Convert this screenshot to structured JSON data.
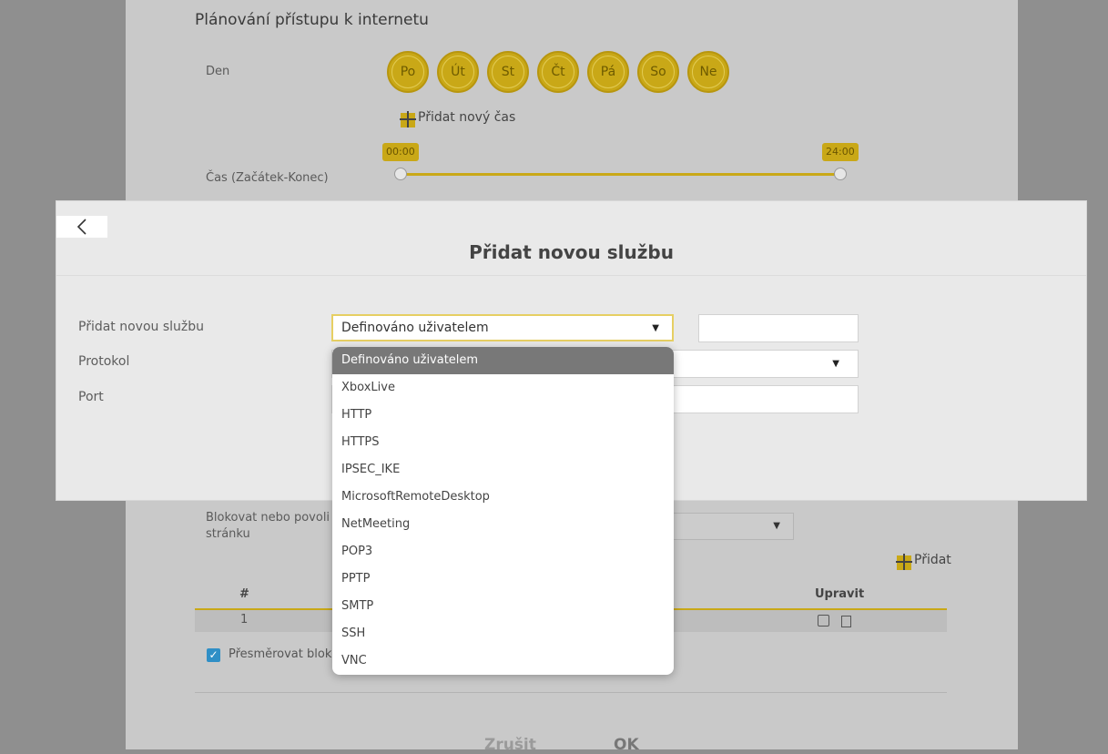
{
  "background": {
    "section_title": "Plánování přístupu k internetu",
    "day_label": "Den",
    "days": [
      "Po",
      "Út",
      "St",
      "Čt",
      "Pá",
      "So",
      "Ne"
    ],
    "add_time_label": "Přidat nový čas",
    "time_label": "Čas (Začátek-Konec)",
    "time_start": "00:00",
    "time_end": "24:00",
    "block_label_line1": "Blokovat nebo povoli",
    "block_label_line2": "stránku",
    "add_label": "Přidat",
    "table": {
      "col_num": "#",
      "col_edit": "Upravit",
      "row_num": "1"
    },
    "redirect_label": "Přesměrovat blok",
    "cancel_label": "Zrušit",
    "ok_label": "OK"
  },
  "modal": {
    "title": "Přidat novou službu",
    "service_label": "Přidat novou službu",
    "protocol_label": "Protokol",
    "port_label": "Port",
    "selected_value": "Definováno uživatelem",
    "options": [
      "Definováno uživatelem",
      "XboxLive",
      "HTTP",
      "HTTPS",
      "IPSEC_IKE",
      "MicrosoftRemoteDesktop",
      "NetMeeting",
      "POP3",
      "PPTP",
      "SMTP",
      "SSH",
      "VNC"
    ]
  },
  "colors": {
    "accent": "#c9a817",
    "selected_option": "#787878",
    "focus_border": "#e6cf63",
    "checkbox": "#2f8fc6"
  },
  "icons": {
    "back": "chevron-left-icon",
    "caret": "caret-down-icon",
    "add": "plus-icon",
    "edit": "edit-icon",
    "delete": "trash-icon",
    "check": "checkmark-icon"
  }
}
